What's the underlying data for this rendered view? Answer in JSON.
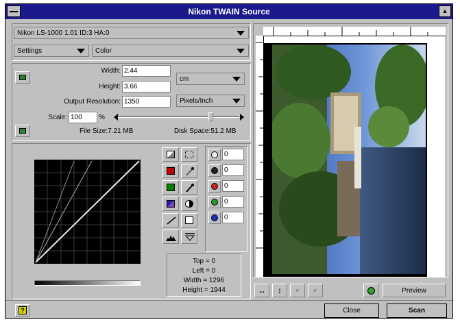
{
  "window": {
    "title": "Nikon TWAIN Source",
    "maximize_glyph": "▲"
  },
  "device": {
    "value": "Nikon  LS-1000      1.01  ID:3 HA:0"
  },
  "settings": {
    "mode_value": "Settings",
    "color_value": "Color"
  },
  "size": {
    "width_label": "Width:",
    "width_value": "2.44",
    "height_label": "Height:",
    "height_value": "3.66",
    "resolution_label": "Output Resolution:",
    "resolution_value": "1350",
    "unit_value": "cm",
    "res_unit_value": "Pixels/Inch",
    "scale_label": "Scale:",
    "scale_value": "100",
    "scale_unit": "%",
    "file_size": "File Size:7.21 MB",
    "disk_space": "Disk Space:51.2 MB"
  },
  "channels": [
    {
      "name": "master",
      "value": "0",
      "color": "#f0f0f0"
    },
    {
      "name": "black",
      "value": "0",
      "color": "#202020"
    },
    {
      "name": "red",
      "value": "0",
      "color": "#d02020"
    },
    {
      "name": "green",
      "value": "0",
      "color": "#20a020"
    },
    {
      "name": "blue",
      "value": "0",
      "color": "#2030c0"
    }
  ],
  "info": {
    "top": "Top = 0",
    "left": "Left = 0",
    "width": "Width = 1296",
    "height": "Height = 1944"
  },
  "buttons": {
    "preview": "Preview",
    "close": "Close",
    "scan": "Scan",
    "help": "?"
  },
  "colors": {
    "title_bar": "#1a1a8c",
    "face": "#c0c0c0",
    "curve_bg": "#000000"
  }
}
